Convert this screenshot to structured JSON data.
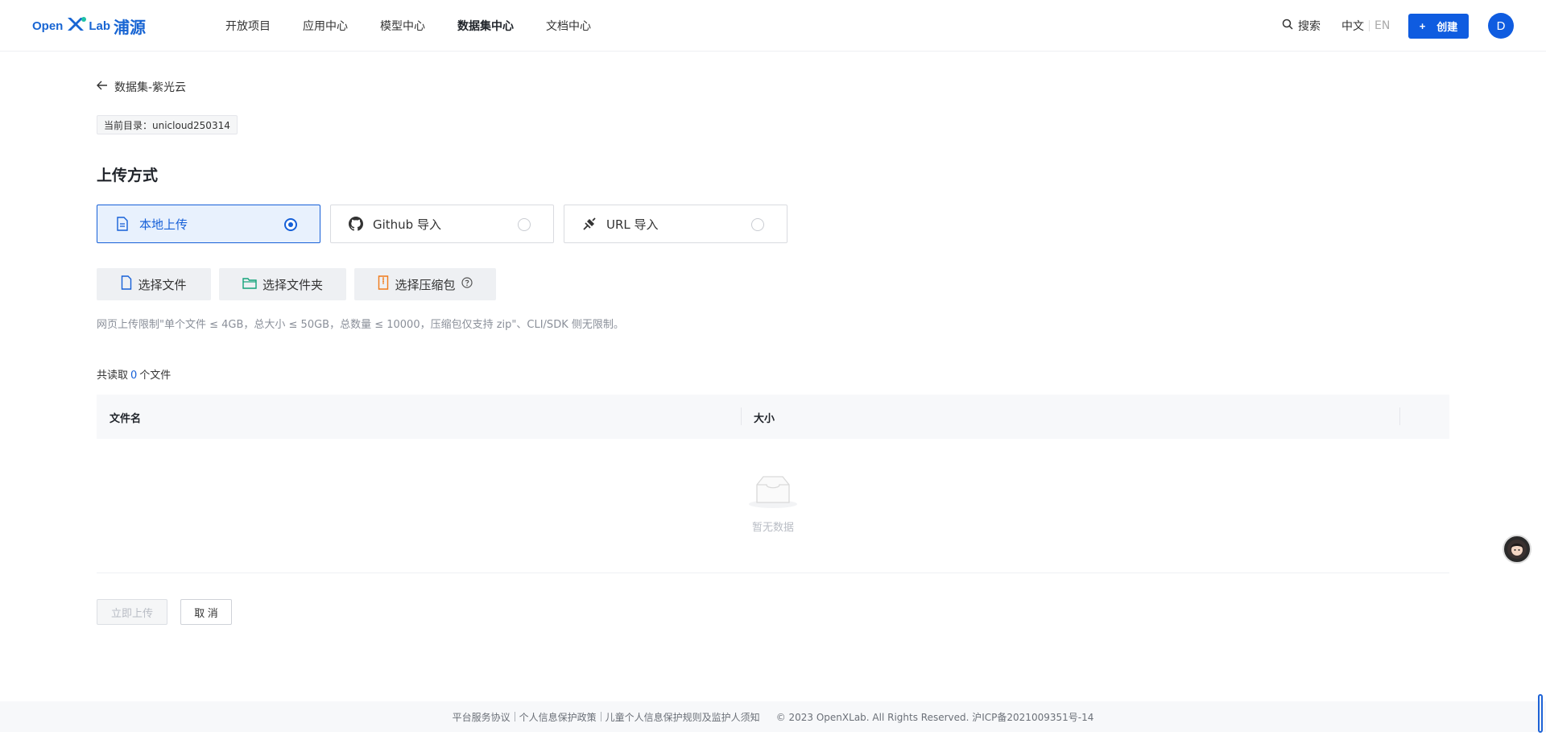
{
  "header": {
    "logo": {
      "part1": "Open",
      "part2": "Lab",
      "part3": "浦源"
    },
    "nav": [
      "开放项目",
      "应用中心",
      "模型中心",
      "数据集中心",
      "文档中心"
    ],
    "active_nav_index": 3,
    "search_label": "搜索",
    "lang_zh": "中文",
    "lang_en": "EN",
    "create_plus": "+",
    "create_label": "创建",
    "avatar_letter": "D"
  },
  "main": {
    "back_label": "数据集-紫光云",
    "dir_badge": "当前目录：unicloud250314",
    "section_title": "上传方式",
    "methods": [
      {
        "label": "本地上传",
        "icon": "file-text-icon",
        "selected": true
      },
      {
        "label": "Github 导入",
        "icon": "github-icon",
        "selected": false
      },
      {
        "label": "URL 导入",
        "icon": "plug-icon",
        "selected": false
      }
    ],
    "pick_buttons": [
      {
        "label": "选择文件",
        "icon": "file-icon"
      },
      {
        "label": "选择文件夹",
        "icon": "folder-icon"
      },
      {
        "label": "选择压缩包",
        "icon": "zip-icon"
      }
    ],
    "hint": "网页上传限制\"单个文件 ≤ 4GB，总大小 ≤ 50GB，总数量 ≤ 10000，压缩包仅支持 zip\"、CLI/SDK 侧无限制。",
    "count_prefix": "共读取",
    "count_value": "0",
    "count_suffix": "个文件",
    "table": {
      "columns": [
        "文件名",
        "大小"
      ],
      "empty_text": "暂无数据"
    },
    "upload_button": "立即上传",
    "cancel_button": "取 消"
  },
  "footer": {
    "links": [
      "平台服务协议",
      "个人信息保护政策",
      "儿童个人信息保护规则及监护人须知"
    ],
    "copyright": "© 2023 OpenXLab. All Rights Reserved. 沪ICP备2021009351号-14"
  },
  "colors": {
    "brand": "#1660d8",
    "create_btn": "#0f5ce0",
    "selected_bg": "#e8f1fd"
  }
}
